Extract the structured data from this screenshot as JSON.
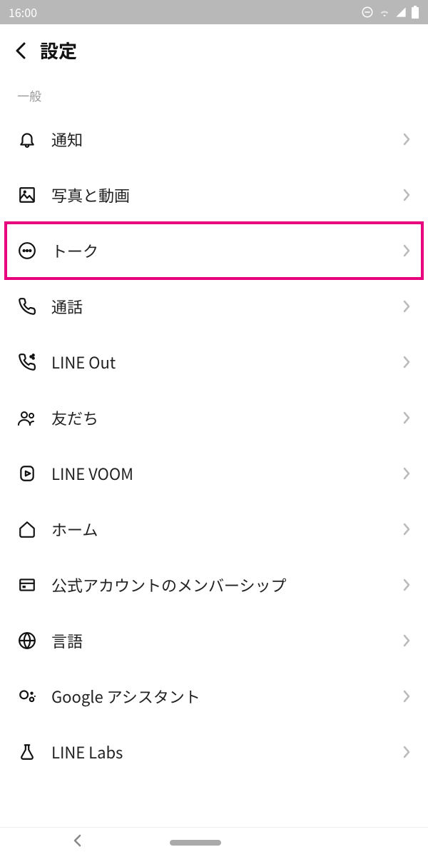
{
  "statusBar": {
    "time": "16:00"
  },
  "header": {
    "title": "設定"
  },
  "section": {
    "label": "一般"
  },
  "items": [
    {
      "id": "notifications",
      "label": "通知"
    },
    {
      "id": "photos-videos",
      "label": "写真と動画"
    },
    {
      "id": "talk",
      "label": "トーク",
      "highlighted": true
    },
    {
      "id": "calls",
      "label": "通話"
    },
    {
      "id": "line-out",
      "label": "LINE Out"
    },
    {
      "id": "friends",
      "label": "友だち"
    },
    {
      "id": "line-voom",
      "label": "LINE VOOM"
    },
    {
      "id": "home",
      "label": "ホーム"
    },
    {
      "id": "official-membership",
      "label": "公式アカウントのメンバーシップ"
    },
    {
      "id": "language",
      "label": "言語"
    },
    {
      "id": "google-assistant",
      "label": "Google アシスタント"
    },
    {
      "id": "line-labs",
      "label": "LINE Labs"
    }
  ]
}
